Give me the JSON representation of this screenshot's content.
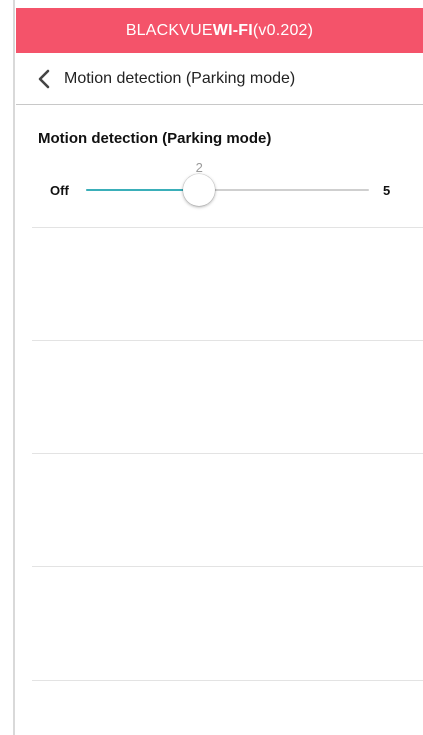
{
  "colors": {
    "titlebar_bg": "#f4536a",
    "accent": "#3aafb9"
  },
  "titlebar": {
    "brand": "BLACKVUE ",
    "wifi": "WI-FI",
    "version": " (v0.202)"
  },
  "navbar": {
    "back_icon": "chevron-left-icon",
    "title": "Motion detection (Parking mode)"
  },
  "setting": {
    "title": "Motion detection (Parking mode)",
    "slider": {
      "min_label": "Off",
      "max_label": "5",
      "min": 0,
      "max": 5,
      "value": 2,
      "value_label": "2"
    }
  }
}
